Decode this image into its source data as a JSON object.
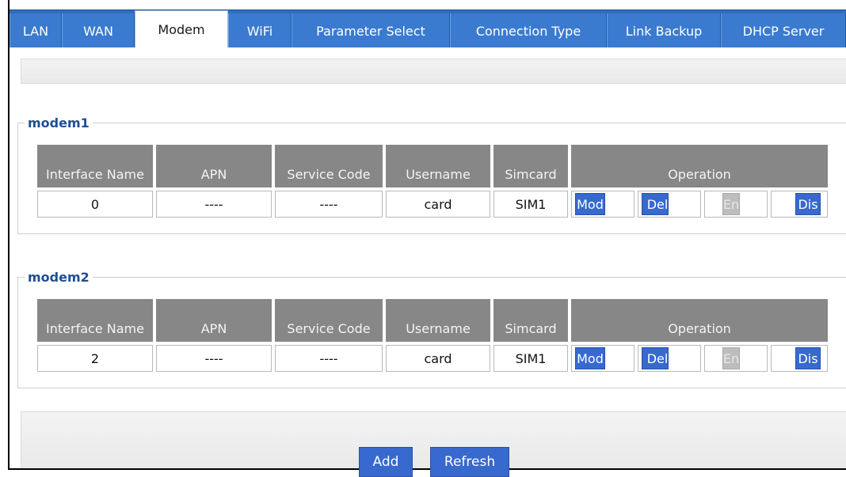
{
  "tabs": [
    {
      "label": "LAN",
      "active": false
    },
    {
      "label": "WAN",
      "active": false
    },
    {
      "label": "Modem",
      "active": true
    },
    {
      "label": "WiFi",
      "active": false
    },
    {
      "label": "Parameter Select",
      "active": false
    },
    {
      "label": "Connection Type",
      "active": false
    },
    {
      "label": "Link Backup",
      "active": false
    },
    {
      "label": "DHCP Server",
      "active": false
    }
  ],
  "table_headers": {
    "interface_name": "Interface Name",
    "apn": "APN",
    "service_code": "Service Code",
    "username": "Username",
    "simcard": "Simcard",
    "operation": "Operation"
  },
  "groups": [
    {
      "legend": "modem1",
      "row": {
        "interface_name": "0",
        "apn": "----",
        "service_code": "----",
        "username": "card",
        "simcard": "SIM1"
      }
    },
    {
      "legend": "modem2",
      "row": {
        "interface_name": "2",
        "apn": "----",
        "service_code": "----",
        "username": "card",
        "simcard": "SIM1"
      }
    }
  ],
  "operations": {
    "mod": "Mod",
    "del": "Del",
    "en": "En",
    "dis": "Dis"
  },
  "footer": {
    "add_label": "Add",
    "refresh_label": "Refresh"
  },
  "colors": {
    "tab_bar": "#2f6fbf",
    "button": "#3769cf",
    "header": "#878787",
    "legend": "#1f4e94"
  }
}
